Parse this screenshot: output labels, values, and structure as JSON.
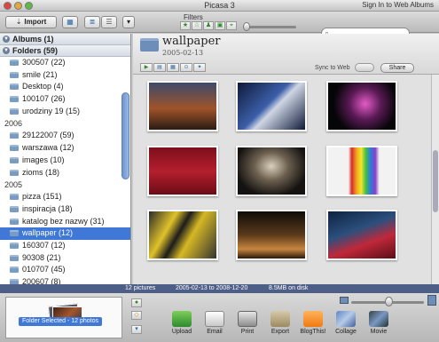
{
  "window": {
    "title": "Picasa 3",
    "signin_link": "Sign In to Web Albums"
  },
  "toolbar": {
    "import_label": "Import",
    "filters_label": "Filters",
    "search_placeholder": ""
  },
  "sidebar": {
    "albums_header": "Albums (1)",
    "folders_header": "Folders (59)",
    "groups": [
      {
        "year": "",
        "folders": [
          "300507 (22)",
          "smile (21)",
          "Desktop (4)",
          "100107 (26)",
          "urodziny 19 (15)"
        ]
      },
      {
        "year": "2006",
        "folders": [
          "29122007 (59)",
          "warszawa (12)",
          "images (10)",
          "zioms (18)"
        ]
      },
      {
        "year": "2005",
        "folders": [
          "pizza (151)",
          "inspiracja (18)",
          "katalog bez nazwy (31)",
          "wallpaper (12)",
          "160307 (12)",
          "90308 (21)",
          "010707 (45)",
          "200607 (8)"
        ]
      }
    ],
    "selected_folder": "wallpaper (12)"
  },
  "album": {
    "title": "wallpaper",
    "date": "2005-02-13",
    "sync_label": "Sync to Web",
    "share_label": "Share"
  },
  "status": {
    "count": "12 pictures",
    "range": "2005-02-13 to 2008-12-20",
    "size": "8.5MB on disk"
  },
  "tray": {
    "label": "Folder Selected - 12 photos"
  },
  "actions": [
    "Upload",
    "Email",
    "Print",
    "Export",
    "BlogThis!",
    "Collage",
    "Movie"
  ],
  "colors": {
    "selection": "#3f78d6",
    "status_bar": "#4d5f86"
  }
}
